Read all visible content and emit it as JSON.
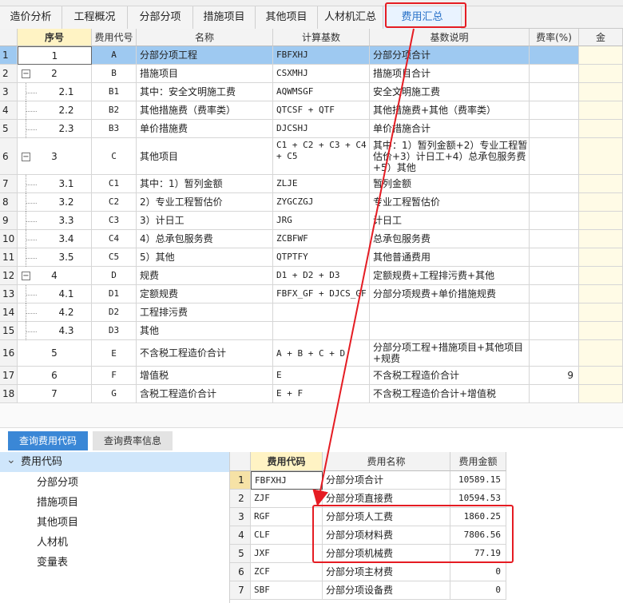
{
  "tabs": [
    {
      "label": "造价分析",
      "active": false
    },
    {
      "label": "工程概况",
      "active": false
    },
    {
      "label": "分部分项",
      "active": false
    },
    {
      "label": "措施项目",
      "active": false
    },
    {
      "label": "其他项目",
      "active": false
    },
    {
      "label": "人材机汇总",
      "active": false
    },
    {
      "label": "费用汇总",
      "active": true
    }
  ],
  "grid": {
    "headers": [
      "序号",
      "费用代号",
      "名称",
      "计算基数",
      "基数说明",
      "费率(%)",
      "金"
    ],
    "rows": [
      {
        "n": "1",
        "seq": "1",
        "code": "A",
        "name": "分部分项工程",
        "base": "FBFXHJ",
        "desc": "分部分项合计",
        "rate": "",
        "level": 0,
        "expand": ""
      },
      {
        "n": "2",
        "seq": "2",
        "code": "B",
        "name": "措施项目",
        "base": "CSXMHJ",
        "desc": "措施项目合计",
        "rate": "",
        "level": 0,
        "expand": "−"
      },
      {
        "n": "3",
        "seq": "2.1",
        "code": "B1",
        "name": "其中：安全文明施工费",
        "base": "AQWMSGF",
        "desc": "安全文明施工费",
        "rate": "",
        "level": 1,
        "expand": ""
      },
      {
        "n": "4",
        "seq": "2.2",
        "code": "B2",
        "name": "其他措施费（费率类）",
        "base": "QTCSF + QTF",
        "desc": "其他措施费+其他（费率类）",
        "rate": "",
        "level": 1,
        "expand": ""
      },
      {
        "n": "5",
        "seq": "2.3",
        "code": "B3",
        "name": "单价措施费",
        "base": "DJCSHJ",
        "desc": "单价措施合计",
        "rate": "",
        "level": 1,
        "expand": ""
      },
      {
        "n": "6",
        "seq": "3",
        "code": "C",
        "name": "其他项目",
        "base": "C1 + C2 + C3 + C4 + C5",
        "desc": "其中：1）暂列金额+2）专业工程暂估价+3）计日工+4）总承包服务费+5）其他",
        "rate": "",
        "level": 0,
        "expand": "−"
      },
      {
        "n": "7",
        "seq": "3.1",
        "code": "C1",
        "name": "其中：1）暂列金额",
        "base": "ZLJE",
        "desc": "暂列金额",
        "rate": "",
        "level": 1,
        "expand": ""
      },
      {
        "n": "8",
        "seq": "3.2",
        "code": "C2",
        "name": "2）专业工程暂估价",
        "base": "ZYGCZGJ",
        "desc": "专业工程暂估价",
        "rate": "",
        "level": 1,
        "expand": ""
      },
      {
        "n": "9",
        "seq": "3.3",
        "code": "C3",
        "name": "3）计日工",
        "base": "JRG",
        "desc": "计日工",
        "rate": "",
        "level": 1,
        "expand": ""
      },
      {
        "n": "10",
        "seq": "3.4",
        "code": "C4",
        "name": "4）总承包服务费",
        "base": "ZCBFWF",
        "desc": "总承包服务费",
        "rate": "",
        "level": 1,
        "expand": ""
      },
      {
        "n": "11",
        "seq": "3.5",
        "code": "C5",
        "name": "5）其他",
        "base": "QTPTFY",
        "desc": "其他普通费用",
        "rate": "",
        "level": 1,
        "expand": ""
      },
      {
        "n": "12",
        "seq": "4",
        "code": "D",
        "name": "规费",
        "base": "D1 + D2 + D3",
        "desc": "定额规费+工程排污费+其他",
        "rate": "",
        "level": 0,
        "expand": "−"
      },
      {
        "n": "13",
        "seq": "4.1",
        "code": "D1",
        "name": "定额规费",
        "base": "FBFX_GF + DJCS_GF",
        "desc": "分部分项规费+单价措施规费",
        "rate": "",
        "level": 1,
        "expand": ""
      },
      {
        "n": "14",
        "seq": "4.2",
        "code": "D2",
        "name": "工程排污费",
        "base": "",
        "desc": "",
        "rate": "",
        "level": 1,
        "expand": ""
      },
      {
        "n": "15",
        "seq": "4.3",
        "code": "D3",
        "name": "其他",
        "base": "",
        "desc": "",
        "rate": "",
        "level": 1,
        "expand": ""
      },
      {
        "n": "16",
        "seq": "5",
        "code": "E",
        "name": "不含税工程造价合计",
        "base": "A + B + C + D",
        "desc": "分部分项工程+措施项目+其他项目+规费",
        "rate": "",
        "level": 0,
        "expand": ""
      },
      {
        "n": "17",
        "seq": "6",
        "code": "F",
        "name": "增值税",
        "base": "E",
        "desc": "不含税工程造价合计",
        "rate": "9",
        "level": 0,
        "expand": ""
      },
      {
        "n": "18",
        "seq": "7",
        "code": "G",
        "name": "含税工程造价合计",
        "base": "E + F",
        "desc": "不含税工程造价合计+增值税",
        "rate": "",
        "level": 0,
        "expand": ""
      }
    ]
  },
  "bottom_tabs": [
    {
      "label": "查询费用代码",
      "active": true
    },
    {
      "label": "查询费率信息",
      "active": false
    }
  ],
  "left_tree": {
    "root": "费用代码",
    "children": [
      "分部分项",
      "措施项目",
      "其他项目",
      "人材机",
      "变量表"
    ]
  },
  "code_table": {
    "headers": [
      "费用代码",
      "费用名称",
      "费用金额"
    ],
    "rows": [
      {
        "n": "1",
        "code": "FBFXHJ",
        "name": "分部分项合计",
        "amount": "10589.15"
      },
      {
        "n": "2",
        "code": "ZJF",
        "name": "分部分项直接费",
        "amount": "10594.53"
      },
      {
        "n": "3",
        "code": "RGF",
        "name": "分部分项人工费",
        "amount": "1860.25"
      },
      {
        "n": "4",
        "code": "CLF",
        "name": "分部分项材料费",
        "amount": "7806.56"
      },
      {
        "n": "5",
        "code": "JXF",
        "name": "分部分项机械费",
        "amount": "77.19"
      },
      {
        "n": "6",
        "code": "ZCF",
        "name": "分部分项主材费",
        "amount": "0"
      },
      {
        "n": "7",
        "code": "SBF",
        "name": "分部分项设备费",
        "amount": "0"
      }
    ]
  },
  "colors": {
    "accent": "#2b73c8",
    "highlight": "#e51c23",
    "selected_row": "#9ec9f1",
    "amount_column": "#fffbe6"
  }
}
